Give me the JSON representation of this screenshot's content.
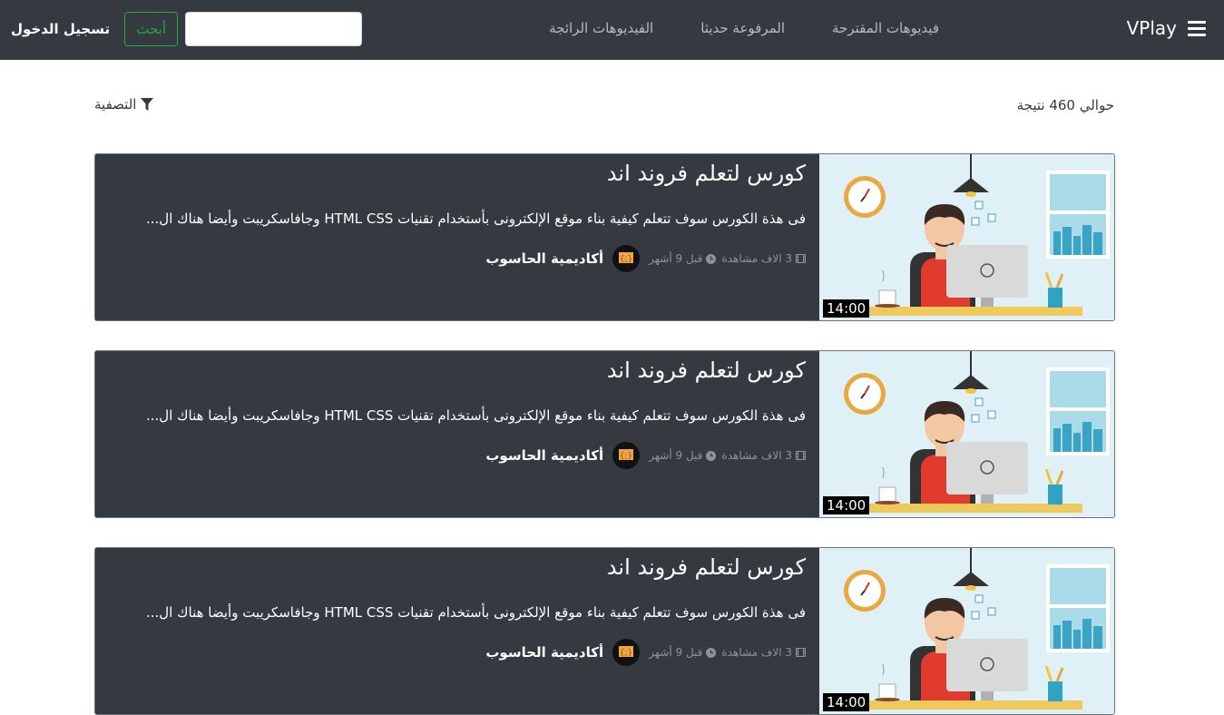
{
  "navbar": {
    "brand": "VPlay",
    "links": [
      "فيديوهات المقترحة",
      "المرفوعة حديثا",
      "الفيديوهات الرائجة"
    ],
    "search_placeholder": "",
    "search_button": "أبحث",
    "login": "تسجيل الدخول"
  },
  "results": {
    "count_text": "حوالي 460 نتيجة",
    "filter_label": "التصفية"
  },
  "videos": [
    {
      "title": "كورس لتعلم فروند اند",
      "description": "فى هذة الكورس سوف تتعلم كيفية بناء موقع الإلكترونى بأستخدام تقنيات HTML CSS وجافاسكريبت وأيضا هناك ال...",
      "views": "3 الاف مشاهدة",
      "time_ago": "قبل 9 أشهر",
      "channel": "أكاديمية الحاسوب",
      "duration": "14:00"
    },
    {
      "title": "كورس لتعلم فروند اند",
      "description": "فى هذة الكورس سوف تتعلم كيفية بناء موقع الإلكترونى بأستخدام تقنيات HTML CSS وجافاسكريبت وأيضا هناك ال...",
      "views": "3 الاف مشاهدة",
      "time_ago": "قبل 9 أشهر",
      "channel": "أكاديمية الحاسوب",
      "duration": "14:00"
    },
    {
      "title": "كورس لتعلم فروند اند",
      "description": "فى هذة الكورس سوف تتعلم كيفية بناء موقع الإلكترونى بأستخدام تقنيات HTML CSS وجافاسكريبت وأيضا هناك ال...",
      "views": "3 الاف مشاهدة",
      "time_ago": "قبل 9 أشهر",
      "channel": "أكاديمية الحاسوب",
      "duration": "14:00"
    }
  ],
  "icons": {
    "menu": "hamburger-menu-icon",
    "filter": "filter-funnel-icon",
    "views": "film-icon",
    "time": "clock-icon"
  },
  "colors": {
    "navbar_bg": "#343a40",
    "card_bg": "#343a40",
    "accent_green": "#28a745",
    "muted_text": "#8c9298"
  }
}
